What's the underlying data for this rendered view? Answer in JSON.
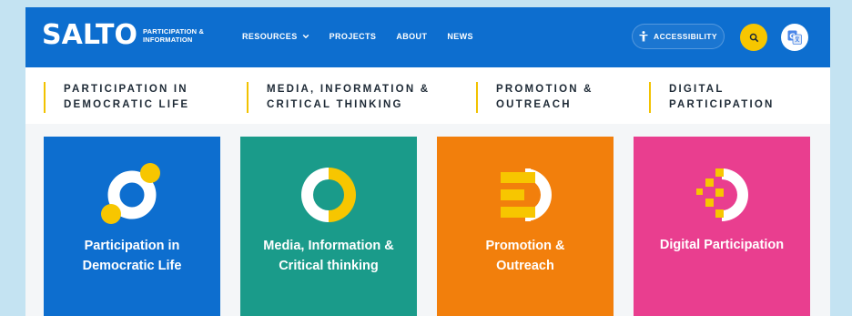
{
  "brand": {
    "logo_text": "SALTO",
    "logo_sub_line1": "PARTICIPATION &",
    "logo_sub_line2": "INFORMATION"
  },
  "nav": {
    "resources": "RESOURCES",
    "projects": "PROJECTS",
    "about": "ABOUT",
    "news": "NEWS"
  },
  "header_actions": {
    "accessibility": "ACCESSIBILITY"
  },
  "categories": [
    {
      "line1": "PARTICIPATION IN",
      "line2": "DEMOCRATIC LIFE"
    },
    {
      "line1": "MEDIA, INFORMATION &",
      "line2": "CRITICAL THINKING"
    },
    {
      "line1": "PROMOTION &",
      "line2": "OUTREACH"
    },
    {
      "line1": "DIGITAL",
      "line2": "PARTICIPATION"
    }
  ],
  "cards": [
    {
      "line1": "Participation in",
      "line2": "Democratic Life",
      "color": "#0d6ecf"
    },
    {
      "line1": "Media, Information &",
      "line2": "Critical thinking",
      "color": "#1a9b8a"
    },
    {
      "line1": "Promotion &",
      "line2": "Outreach",
      "color": "#f27f0c"
    },
    {
      "line1": "Digital Participation",
      "line2": "",
      "color": "#e93e8f"
    }
  ],
  "colors": {
    "header_bg": "#0d6ecf",
    "accent_yellow": "#f7c600",
    "page_frame": "#c4e3f2"
  },
  "icons": [
    "accessibility-icon",
    "search-icon",
    "translate-icon",
    "chevron-down-icon"
  ]
}
